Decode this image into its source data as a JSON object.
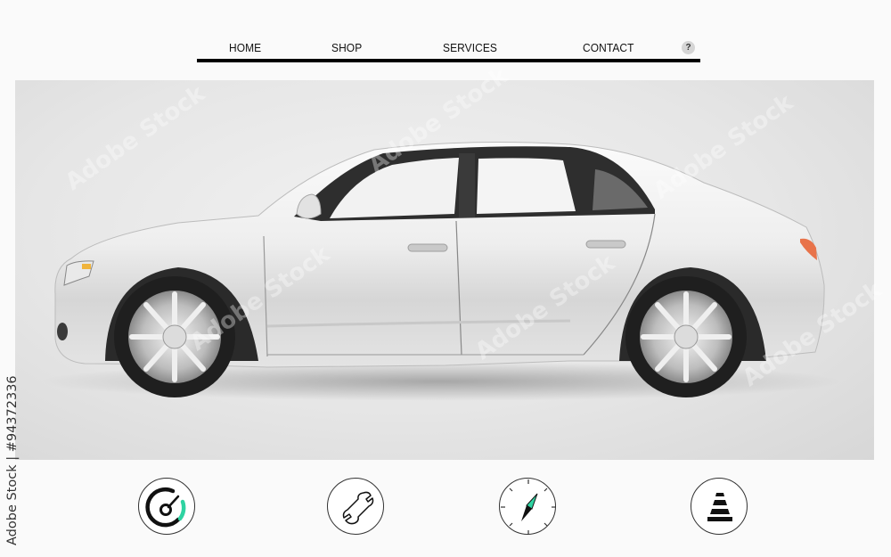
{
  "nav": {
    "items": [
      {
        "label": "HOME"
      },
      {
        "label": "SHOP"
      },
      {
        "label": "SERVICES"
      },
      {
        "label": "CONTACT"
      }
    ],
    "help_label": "?"
  },
  "hero": {
    "image": "white-sedan-side-view",
    "car_color": "#eeeeee",
    "window_color": "#2e2e2e",
    "taillight_color": "#e8734a",
    "headlight_color": "#f0b43c"
  },
  "features": [
    {
      "icon": "speedometer-icon",
      "accent": "#2fd3a2"
    },
    {
      "icon": "wrench-icon"
    },
    {
      "icon": "compass-icon",
      "accent": "#2fd3a2"
    },
    {
      "icon": "traffic-cone-icon"
    }
  ],
  "watermark": {
    "credit": "Adobe Stock | #94372336",
    "text": "Adobe Stock"
  }
}
